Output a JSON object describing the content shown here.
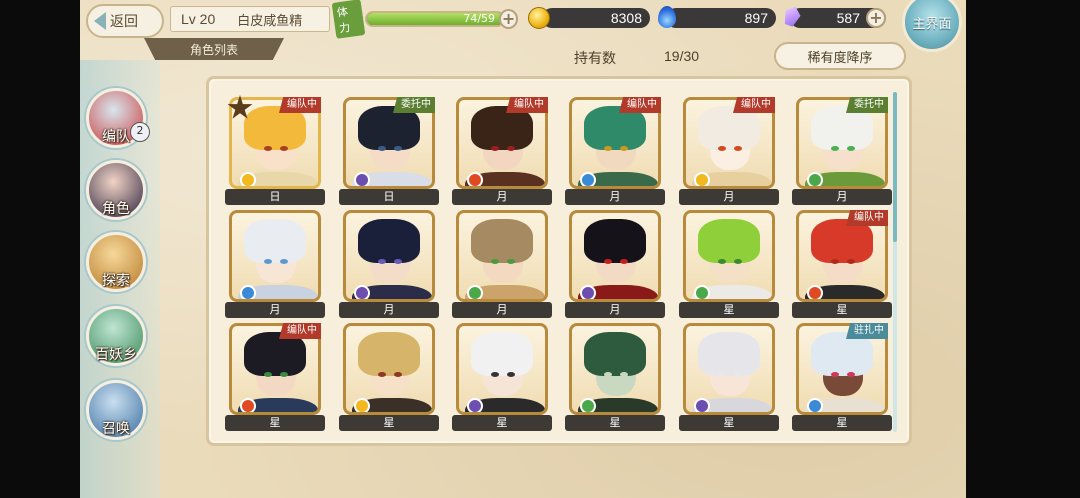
{
  "header": {
    "back_label": "返回",
    "level": "Lv 20",
    "player_name": "白皮咸鱼精",
    "stamina_label": "体力",
    "stamina_text": "74/59",
    "stamina_ratio": 1.0,
    "gold": "8308",
    "soul": "897",
    "crystal": "587",
    "main_menu_label": "主界面",
    "list_tab_label": "角色列表",
    "owned_label": "持有数",
    "owned_value": "19/30",
    "sort_label": "稀有度降序"
  },
  "nav": {
    "items": [
      {
        "label": "编队",
        "badge": "2",
        "color": "#d8e6ee",
        "accent": "#c93a3a"
      },
      {
        "label": "角色",
        "color": "#f2d4c6",
        "accent": "#2d2540"
      },
      {
        "label": "探索",
        "color": "#f7d89a",
        "accent": "#b57a2a"
      },
      {
        "label": "百妖乡",
        "color": "#bfe5d2",
        "accent": "#3a8a5a"
      },
      {
        "label": "召唤",
        "color": "#c9dff0",
        "accent": "#3a6ea0"
      }
    ]
  },
  "characters": [
    {
      "rank": "日",
      "tag": "编队中",
      "tag_type": "red",
      "hair": "#f3b93a",
      "skin": "#f8e1c8",
      "eye": "#a84020",
      "cloth": "#e8d7a8",
      "attr": "#f2b81e",
      "featured": true
    },
    {
      "rank": "日",
      "tag": "委托中",
      "tag_type": "green",
      "hair": "#1d2230",
      "skin": "#f4dcc6",
      "eye": "#3a5a8a",
      "cloth": "#d9dde8",
      "attr": "#6c4db0"
    },
    {
      "rank": "月",
      "tag": "编队中",
      "tag_type": "red",
      "hair": "#3a2418",
      "skin": "#f2d6bf",
      "eye": "#9a2020",
      "cloth": "#5a3020",
      "attr": "#e04a22"
    },
    {
      "rank": "月",
      "tag": "编队中",
      "tag_type": "red",
      "hair": "#2f8a6a",
      "skin": "#f1d9c0",
      "eye": "#c89a20",
      "cloth": "#3a6a4a",
      "attr": "#3a8ad8"
    },
    {
      "rank": "月",
      "tag": "编队中",
      "tag_type": "red",
      "hair": "#f1ebe1",
      "skin": "#fbeee2",
      "eye": "#d34a20",
      "cloth": "#e8cfa0",
      "attr": "#f2b81e"
    },
    {
      "rank": "月",
      "tag": "委托中",
      "tag_type": "green",
      "hair": "#f1f1ee",
      "skin": "#f6e0cc",
      "eye": "#4ab050",
      "cloth": "#6a9a3a",
      "attr": "#4aa84a"
    },
    {
      "rank": "月",
      "tag": "",
      "tag_type": "",
      "hair": "#e9edf2",
      "skin": "#f7e6d6",
      "eye": "#5a9ad0",
      "cloth": "#c8d2e0",
      "attr": "#3a8ad8"
    },
    {
      "rank": "月",
      "tag": "",
      "tag_type": "",
      "hair": "#1a1f3a",
      "skin": "#f3dcc8",
      "eye": "#6a5ab8",
      "cloth": "#2a2c4a",
      "attr": "#6c4db0"
    },
    {
      "rank": "月",
      "tag": "",
      "tag_type": "",
      "hair": "#a58a62",
      "skin": "#f3d9c0",
      "eye": "#4a9a40",
      "cloth": "#caa46a",
      "attr": "#4aa84a"
    },
    {
      "rank": "月",
      "tag": "",
      "tag_type": "",
      "hair": "#15121a",
      "skin": "#f3dac4",
      "eye": "#c02020",
      "cloth": "#8a1a1a",
      "attr": "#6c4db0"
    },
    {
      "rank": "星",
      "tag": "",
      "tag_type": "",
      "hair": "#8ecf3a",
      "skin": "#f4e0c6",
      "eye": "#3a8a30",
      "cloth": "#eceae6",
      "attr": "#4aa84a"
    },
    {
      "rank": "星",
      "tag": "编队中",
      "tag_type": "red",
      "hair": "#d83a2a",
      "skin": "#f4dcc6",
      "eye": "#b02a1a",
      "cloth": "#2a2a2a",
      "attr": "#e04a22"
    },
    {
      "rank": "星",
      "tag": "编队中",
      "tag_type": "red",
      "hair": "#1c1a22",
      "skin": "#f3d9c4",
      "eye": "#3a8a40",
      "cloth": "#2a3a5a",
      "attr": "#e04a22"
    },
    {
      "rank": "星",
      "tag": "",
      "tag_type": "",
      "hair": "#d6b46a",
      "skin": "#f6e0c8",
      "eye": "#8a3a20",
      "cloth": "#3a3028",
      "attr": "#f2b81e"
    },
    {
      "rank": "星",
      "tag": "",
      "tag_type": "",
      "hair": "#f1f1f1",
      "skin": "#f6e4d6",
      "eye": "#333333",
      "cloth": "#2a2a2a",
      "attr": "#6c4db0"
    },
    {
      "rank": "星",
      "tag": "",
      "tag_type": "",
      "hair": "#2e5a3e",
      "skin": "#c9d8c0",
      "eye": "#c8d8c0",
      "cloth": "#2a3a2a",
      "attr": "#4aa84a"
    },
    {
      "rank": "星",
      "tag": "",
      "tag_type": "",
      "hair": "#e6e6ea",
      "skin": "#f7e6d8",
      "eye": "#e8e8e8",
      "cloth": "#d8d8dc",
      "attr": "#6c4db0"
    },
    {
      "rank": "星",
      "tag": "驻扎中",
      "tag_type": "teal",
      "hair": "#dfe9f2",
      "skin": "#7a4a38",
      "eye": "#d03a5a",
      "cloth": "#e8e0d0",
      "attr": "#3a8ad8"
    }
  ]
}
